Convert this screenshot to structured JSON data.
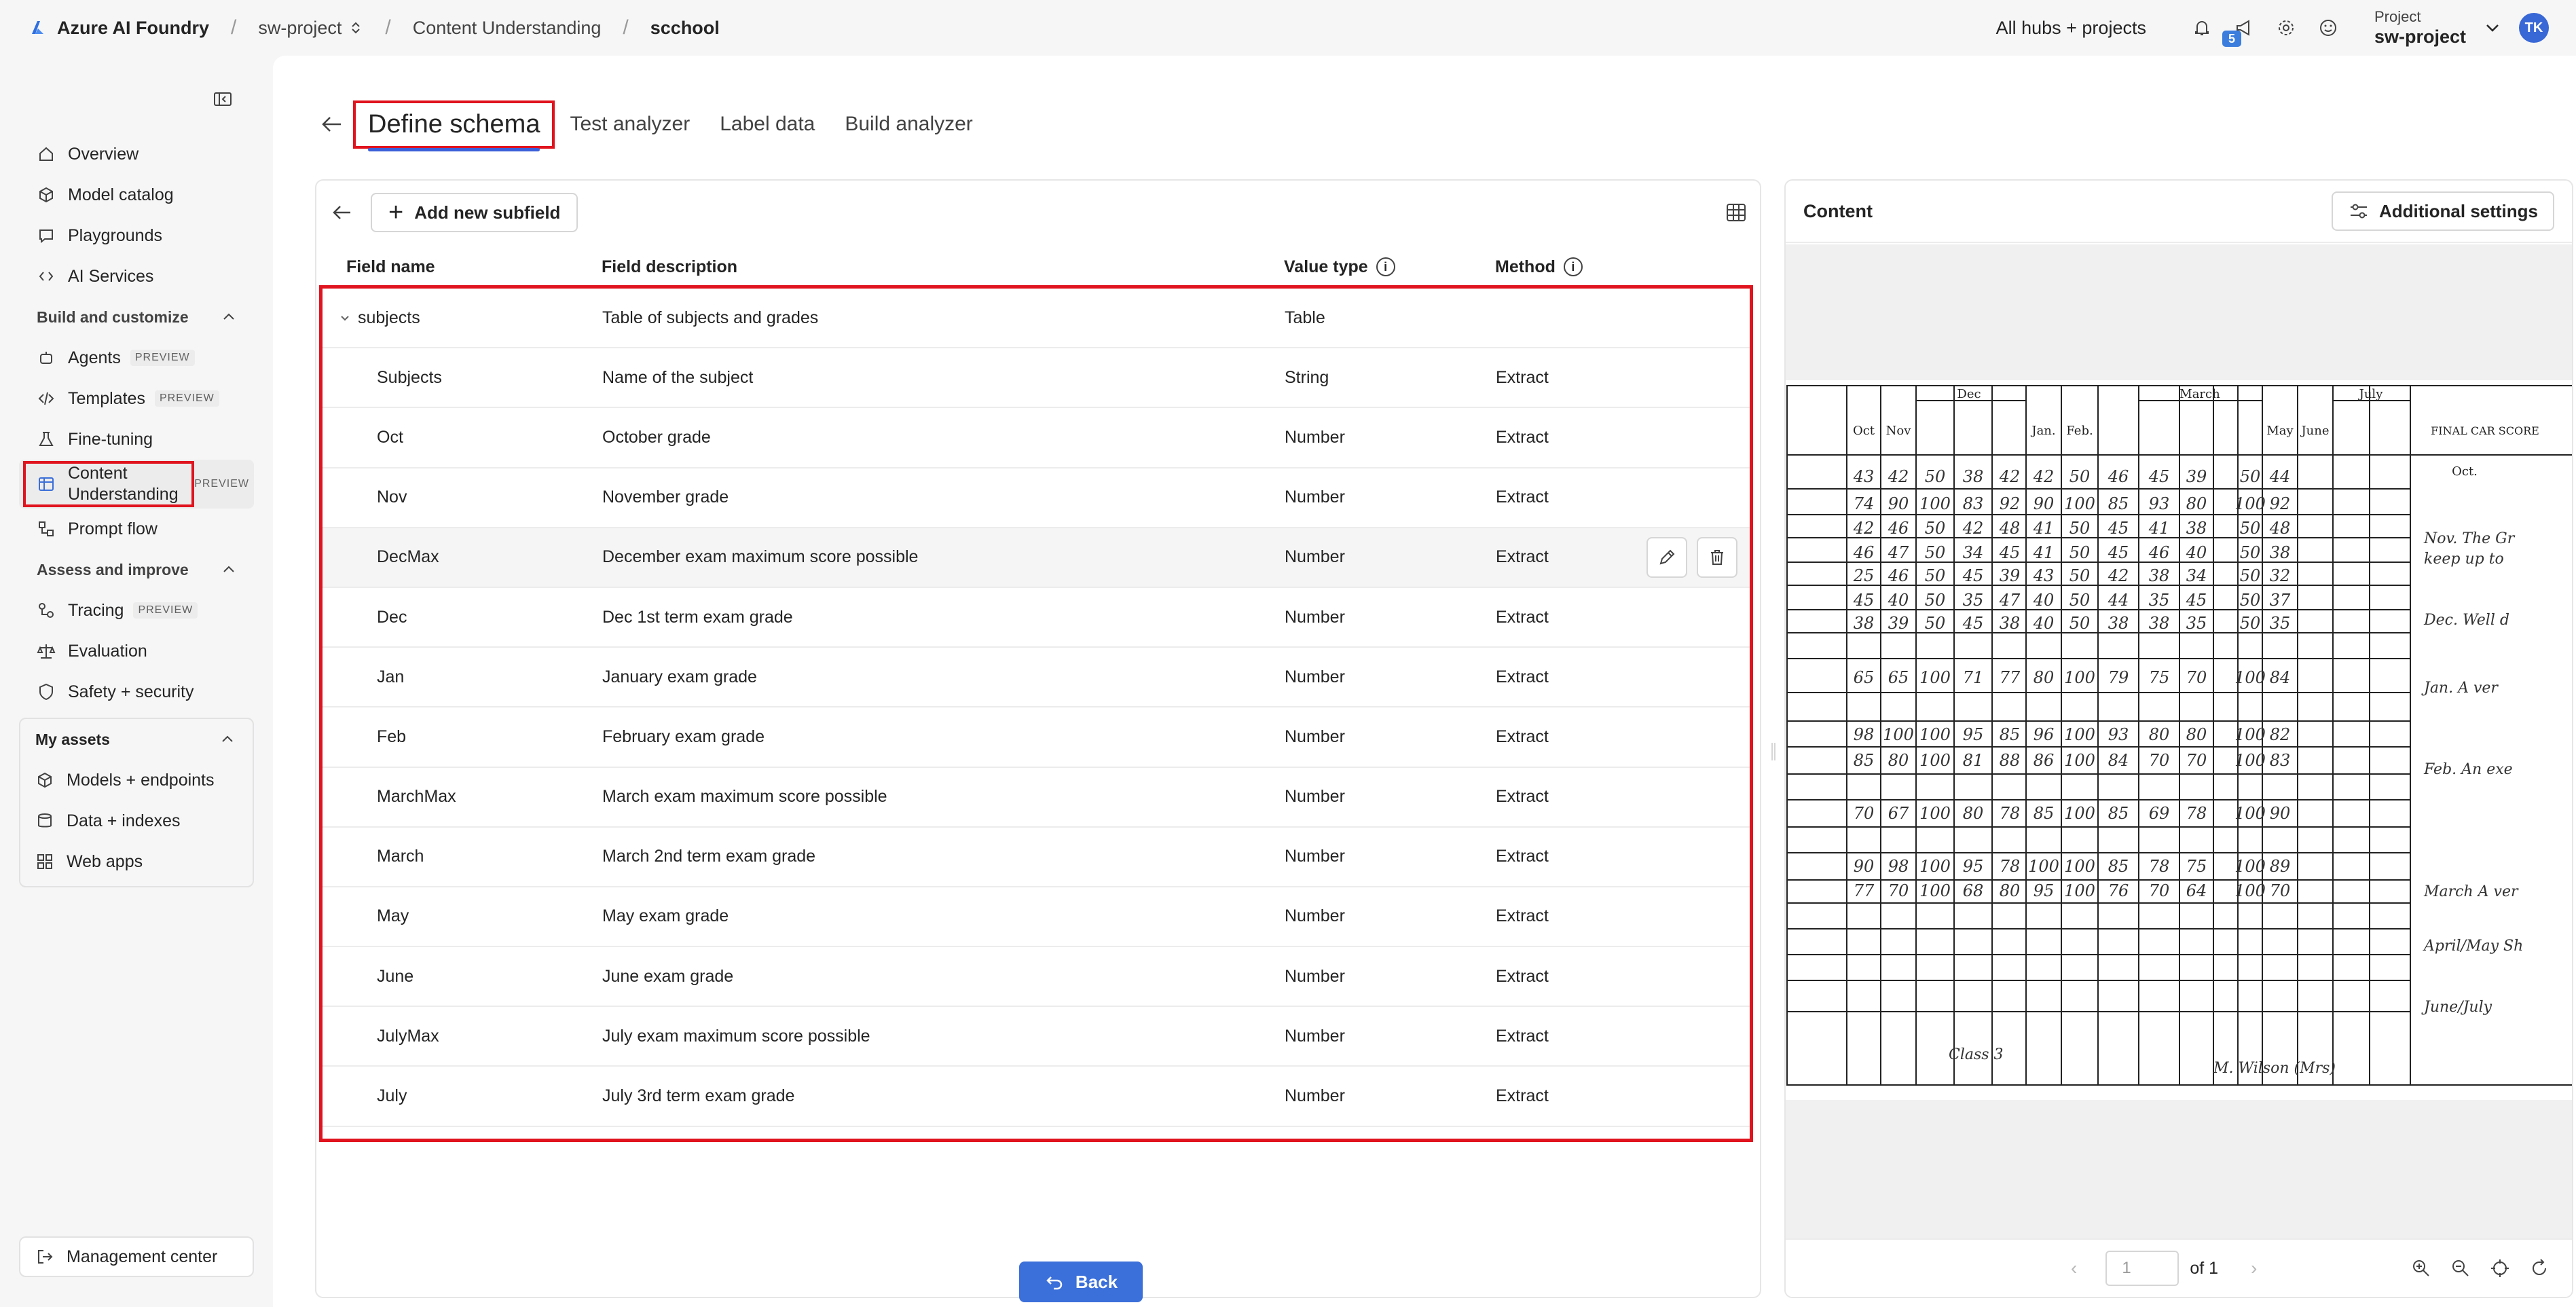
{
  "topbar": {
    "brand": "Azure AI Foundry",
    "project": "sw-project",
    "section": "Content Understanding",
    "current": "scchool",
    "hubs": "All hubs + projects",
    "notification_count": "5",
    "project_label": "Project",
    "project_name": "sw-project",
    "avatar_initials": "TK"
  },
  "sidebar": {
    "items_top": [
      {
        "label": "Overview",
        "icon": "home-icon"
      },
      {
        "label": "Model catalog",
        "icon": "cube-icon"
      },
      {
        "label": "Playgrounds",
        "icon": "chat-icon"
      },
      {
        "label": "AI Services",
        "icon": "link-icon"
      }
    ],
    "build_section": "Build and customize",
    "build_items": [
      {
        "label": "Agents",
        "badge": "PREVIEW"
      },
      {
        "label": "Templates",
        "badge": "PREVIEW"
      },
      {
        "label": "Fine-tuning",
        "badge": ""
      },
      {
        "label": "Content Understanding",
        "badge": "PREVIEW"
      },
      {
        "label": "Prompt flow",
        "badge": ""
      }
    ],
    "assess_section": "Assess and improve",
    "assess_items": [
      {
        "label": "Tracing",
        "badge": "PREVIEW"
      },
      {
        "label": "Evaluation",
        "badge": ""
      },
      {
        "label": "Safety + security",
        "badge": ""
      }
    ],
    "assets_section": "My assets",
    "assets_items": [
      {
        "label": "Models + endpoints"
      },
      {
        "label": "Data + indexes"
      },
      {
        "label": "Web apps"
      }
    ],
    "management": "Management center"
  },
  "tabs": [
    "Define schema",
    "Test analyzer",
    "Label data",
    "Build analyzer"
  ],
  "schema": {
    "add_subfield": "Add new subfield",
    "headers": {
      "name": "Field name",
      "description": "Field description",
      "value_type": "Value type",
      "method": "Method"
    },
    "rows": [
      {
        "name": "subjects",
        "description": "Table of subjects and grades",
        "type": "Table",
        "method": ""
      },
      {
        "name": "Subjects",
        "description": "Name of the subject",
        "type": "String",
        "method": "Extract"
      },
      {
        "name": "Oct",
        "description": "October grade",
        "type": "Number",
        "method": "Extract"
      },
      {
        "name": "Nov",
        "description": "November grade",
        "type": "Number",
        "method": "Extract"
      },
      {
        "name": "DecMax",
        "description": "December exam maximum score possible",
        "type": "Number",
        "method": "Extract"
      },
      {
        "name": "Dec",
        "description": "Dec 1st term exam grade",
        "type": "Number",
        "method": "Extract"
      },
      {
        "name": "Jan",
        "description": "January exam grade",
        "type": "Number",
        "method": "Extract"
      },
      {
        "name": "Feb",
        "description": "February exam grade",
        "type": "Number",
        "method": "Extract"
      },
      {
        "name": "MarchMax",
        "description": "March exam maximum score possible",
        "type": "Number",
        "method": "Extract"
      },
      {
        "name": "March",
        "description": "March 2nd term exam grade",
        "type": "Number",
        "method": "Extract"
      },
      {
        "name": "May",
        "description": "May exam grade",
        "type": "Number",
        "method": "Extract"
      },
      {
        "name": "June",
        "description": "June exam grade",
        "type": "Number",
        "method": "Extract"
      },
      {
        "name": "JulyMax",
        "description": "July exam maximum score possible",
        "type": "Number",
        "method": "Extract"
      },
      {
        "name": "July",
        "description": "July 3rd term exam grade",
        "type": "Number",
        "method": "Extract"
      }
    ],
    "back_button": "Back"
  },
  "content": {
    "title": "Content",
    "settings": "Additional settings",
    "page_number": "1",
    "page_of": "of 1",
    "document_headers": [
      "Dec",
      "March",
      "July",
      "Oct",
      "Nov",
      "Jan.",
      "Feb.",
      "May",
      "June",
      "FINAL CAR SCORE",
      "Oct."
    ]
  },
  "colors": {
    "accent": "#3b6fd9",
    "highlight": "#e0141e"
  }
}
